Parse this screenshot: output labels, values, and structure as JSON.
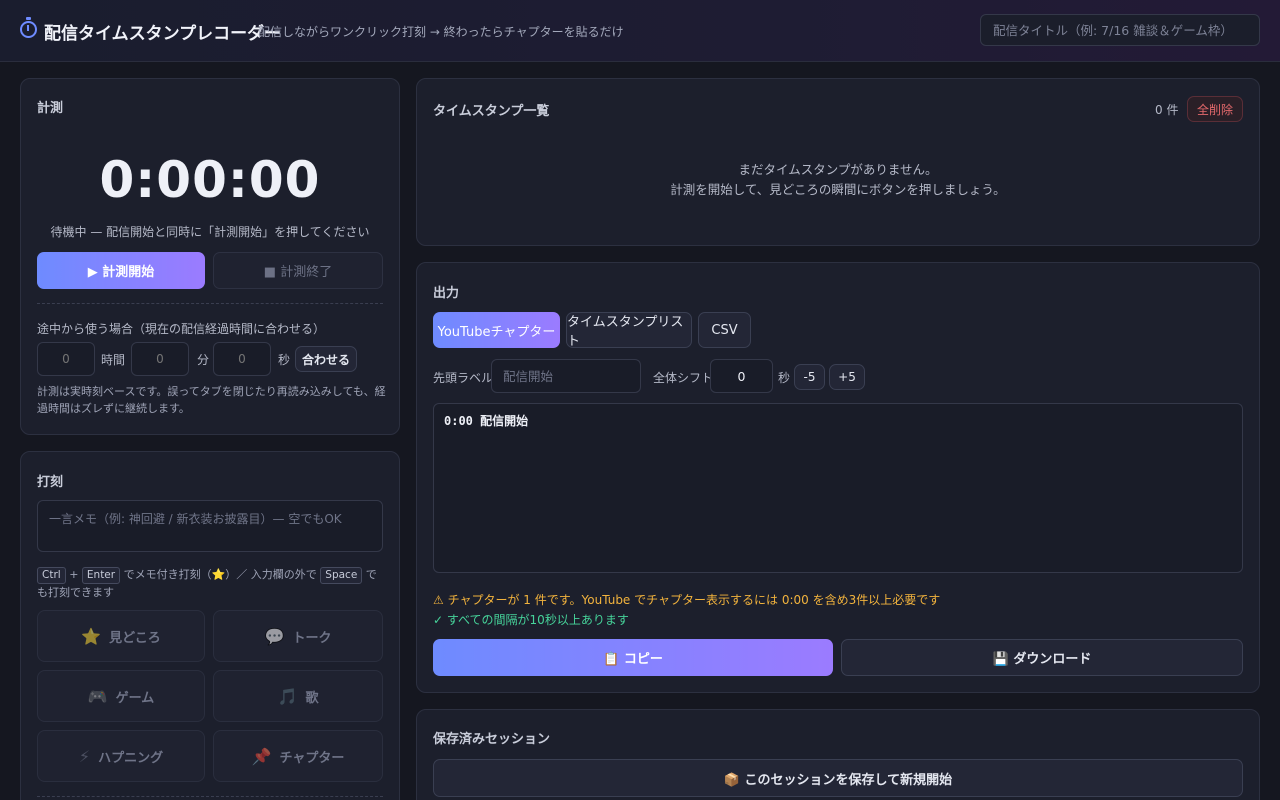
{
  "header": {
    "title": "配信タイムスタンプレコーダー",
    "subtitle": "配信しながらワンクリック打刻 → 終わったらチャプターを貼るだけ",
    "title_placeholder": "配信タイトル（例: 7/16 雑談＆ゲーム枠）"
  },
  "measure": {
    "title": "計測",
    "timer": "0:00:00",
    "status": "待機中 — 配信開始と同時に「計測開始」を押してください",
    "start_label": "▶ 計測開始",
    "stop_label": "■ 計測終了",
    "sync_label": "途中から使う場合（現在の配信経過時間に合わせる）",
    "hours_placeholder": "0",
    "hours_unit": "時間",
    "minutes_placeholder": "0",
    "minutes_unit": "分",
    "seconds_placeholder": "0",
    "seconds_unit": "秒",
    "apply_label": "合わせる",
    "note": "計測は実時刻ベースです。誤ってタブを閉じたり再読み込みしても、経過時間はズレずに継続します。"
  },
  "stamp": {
    "title": "打刻",
    "memo_placeholder": "一言メモ（例: 神回避 / 新衣装お披露目）— 空でもOK",
    "hint_key1": "Ctrl",
    "hint_plus": "+",
    "hint_key2": "Enter",
    "hint_mid": "でメモ付き打刻（⭐）／ 入力欄の外で",
    "hint_key3": "Space",
    "hint_end": "でも打刻できます",
    "buttons": [
      {
        "icon": "⭐",
        "label": "見どころ"
      },
      {
        "icon": "💬",
        "label": "トーク"
      },
      {
        "icon": "🎮",
        "label": "ゲーム"
      },
      {
        "icon": "🎵",
        "label": "歌"
      },
      {
        "icon": "⚡",
        "label": "ハプニング"
      },
      {
        "icon": "📌",
        "label": "チャプター"
      }
    ]
  },
  "list": {
    "title": "タイムスタンプ一覧",
    "count": "0 件",
    "clear_label": "全削除",
    "empty_line1": "まだタイムスタンプがありません。",
    "empty_line2": "計測を開始して、見どころの瞬間にボタンを押しましょう。"
  },
  "output": {
    "title": "出力",
    "tabs": [
      "YouTubeチャプター",
      "タイムスタンプリスト",
      "CSV"
    ],
    "head_label": "先頭ラベル:",
    "head_placeholder": "配信開始",
    "shift_label": "全体シフト:",
    "shift_value": "0",
    "shift_unit": "秒",
    "minus_label": "-5",
    "plus_label": "+5",
    "text": "0:00 配信開始",
    "warning": "⚠ チャプターが 1 件です。YouTube でチャプター表示するには 0:00 を含め3件以上必要です",
    "ok": "✓ すべての間隔が10秒以上あります",
    "copy_label": "📋 コピー",
    "download_label": "💾 ダウンロード"
  },
  "sessions": {
    "title": "保存済みセッション",
    "save_label": "📦 このセッションを保存して新規開始"
  },
  "colors": {
    "accent_start": "#6e8bff",
    "accent_end": "#9b7bff",
    "warning": "#f2b33d",
    "ok": "#46d39a",
    "danger": "#e4696c"
  }
}
